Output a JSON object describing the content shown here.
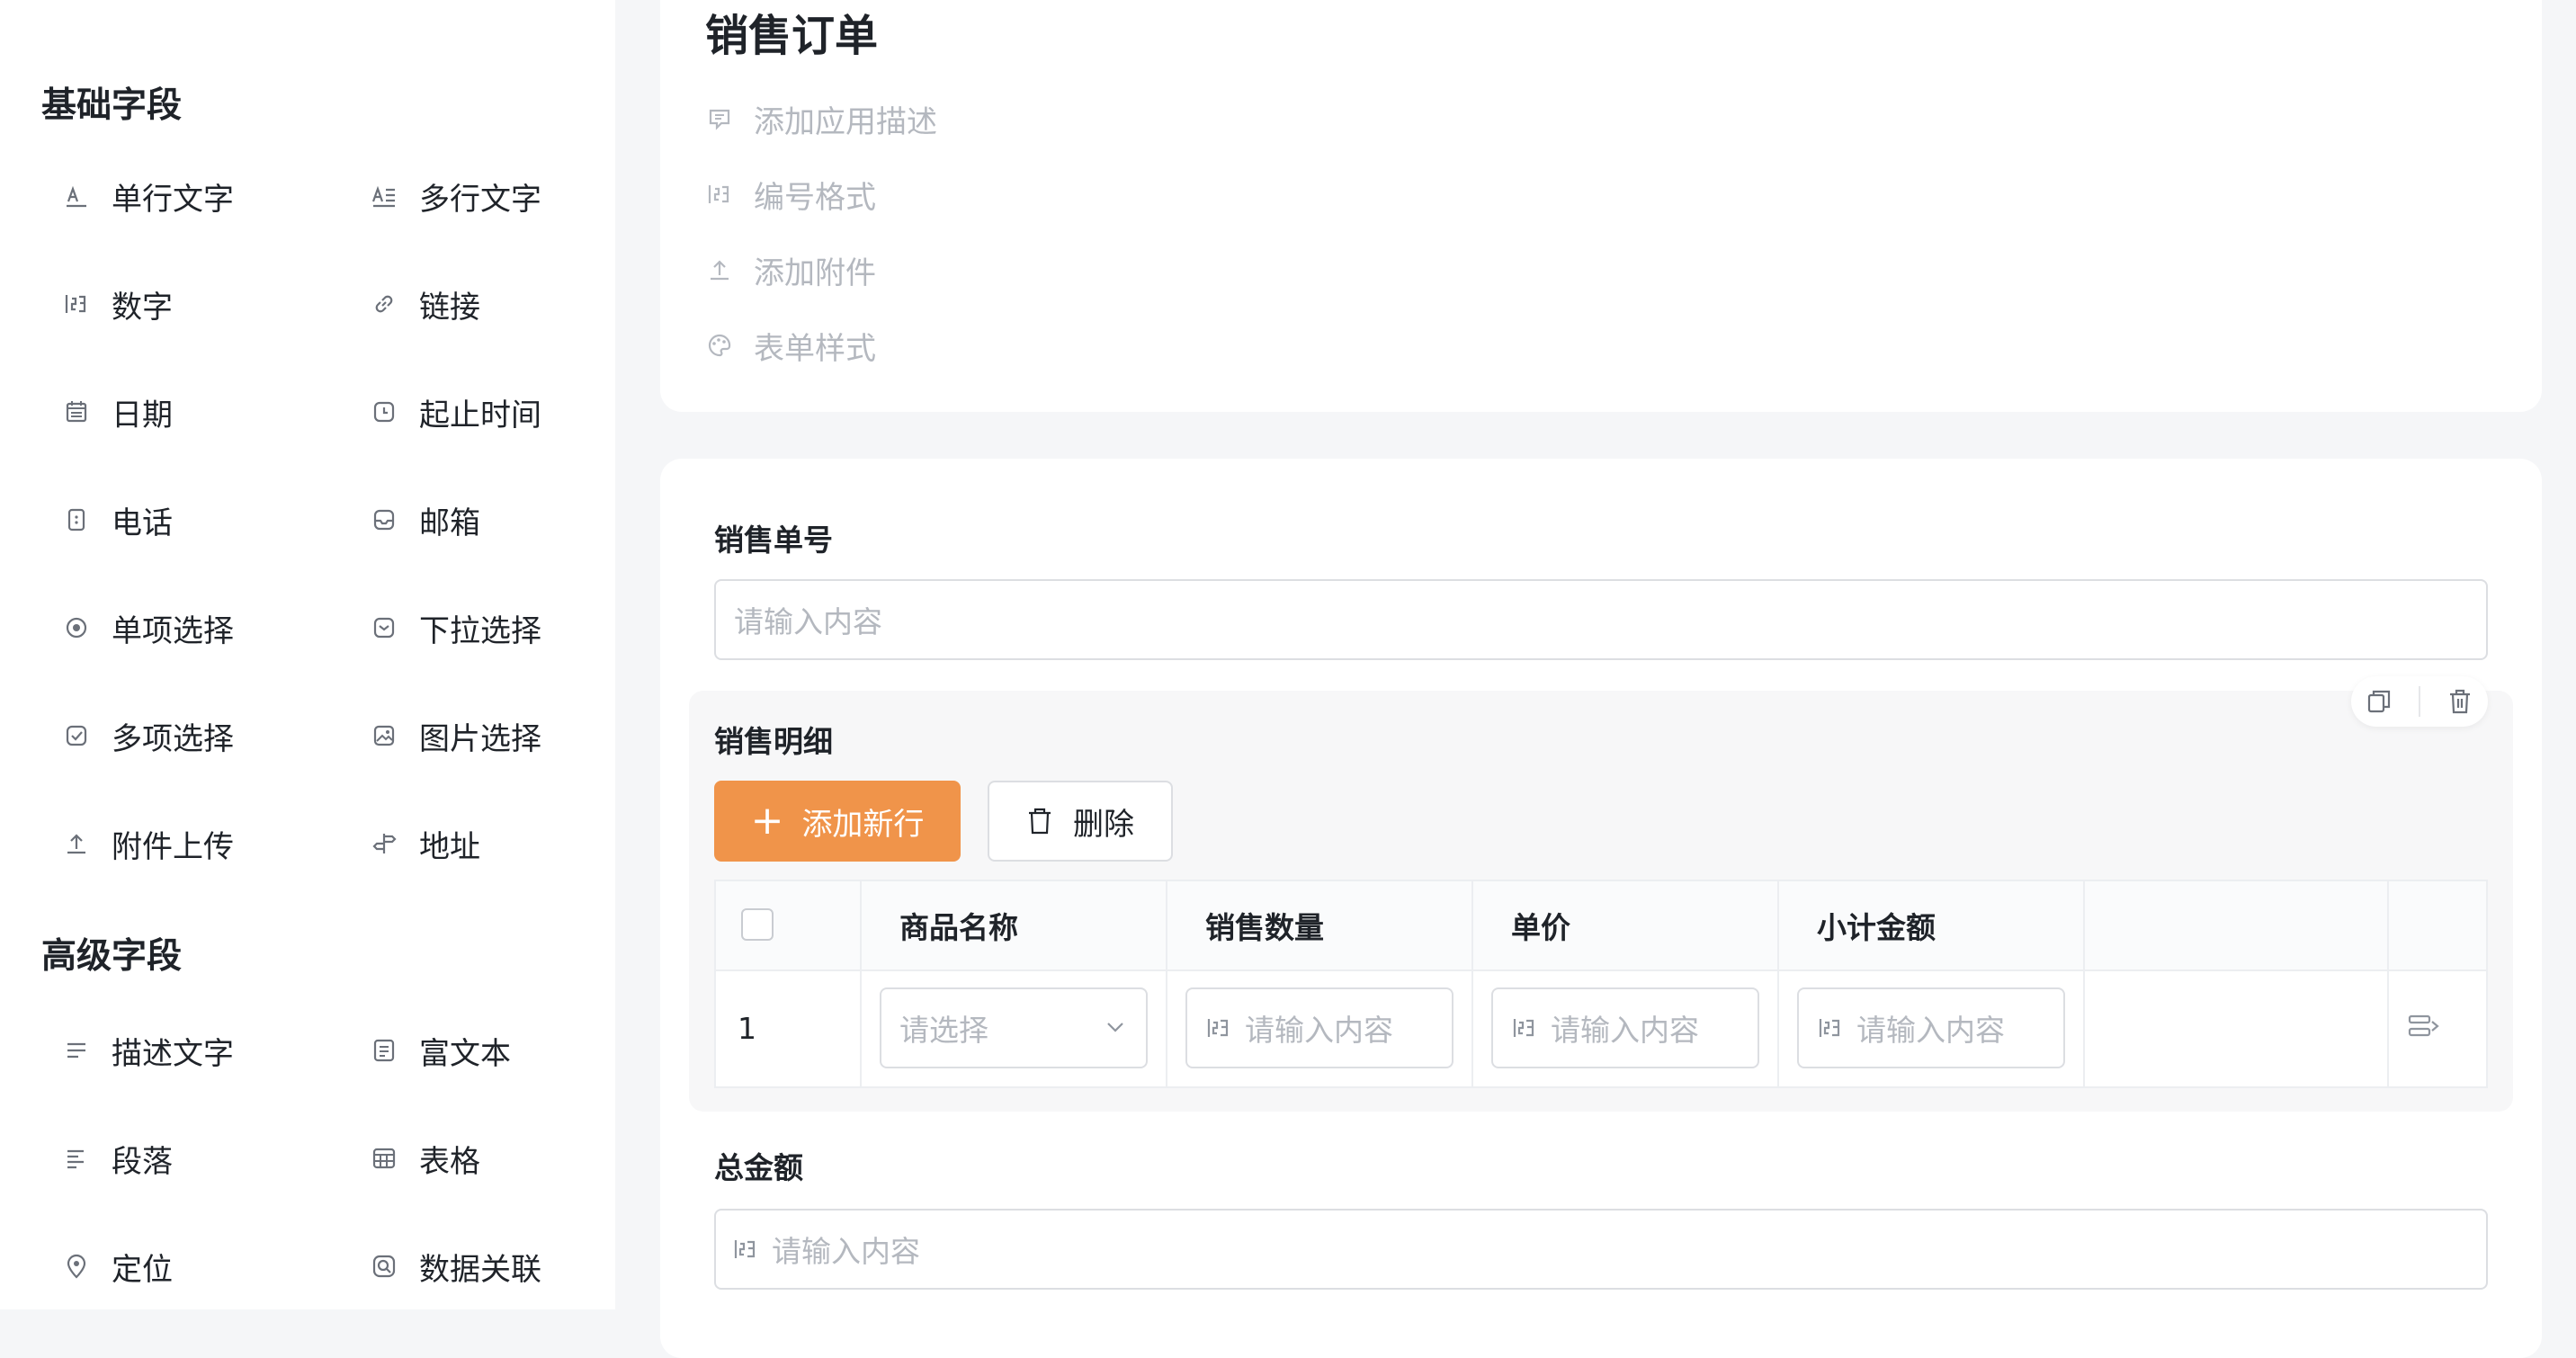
{
  "sidebar": {
    "basic_title": "基础字段",
    "advanced_title": "高级字段",
    "basic_fields": [
      {
        "label": "单行文字",
        "icon": "single-line-text-icon"
      },
      {
        "label": "多行文字",
        "icon": "multi-line-text-icon"
      },
      {
        "label": "数字",
        "icon": "number-icon"
      },
      {
        "label": "链接",
        "icon": "link-icon"
      },
      {
        "label": "日期",
        "icon": "calendar-icon"
      },
      {
        "label": "起止时间",
        "icon": "time-range-icon"
      },
      {
        "label": "电话",
        "icon": "phone-icon"
      },
      {
        "label": "邮箱",
        "icon": "mail-icon"
      },
      {
        "label": "单项选择",
        "icon": "radio-icon"
      },
      {
        "label": "下拉选择",
        "icon": "dropdown-icon"
      },
      {
        "label": "多项选择",
        "icon": "checkbox-icon"
      },
      {
        "label": "图片选择",
        "icon": "image-icon"
      },
      {
        "label": "附件上传",
        "icon": "upload-icon"
      },
      {
        "label": "地址",
        "icon": "signpost-icon"
      }
    ],
    "advanced_fields": [
      {
        "label": "描述文字",
        "icon": "description-icon"
      },
      {
        "label": "富文本",
        "icon": "rich-text-icon"
      },
      {
        "label": "段落",
        "icon": "paragraph-icon"
      },
      {
        "label": "表格",
        "icon": "table-icon"
      },
      {
        "label": "定位",
        "icon": "location-pin-icon"
      },
      {
        "label": "数据关联",
        "icon": "data-link-icon"
      }
    ]
  },
  "form": {
    "title": "销售订单",
    "options": [
      {
        "label": "添加应用描述",
        "icon": "comment-icon"
      },
      {
        "label": "编号格式",
        "icon": "number-format-icon"
      },
      {
        "label": "添加附件",
        "icon": "upload-icon"
      },
      {
        "label": "表单样式",
        "icon": "palette-icon"
      }
    ],
    "order_no": {
      "label": "销售单号",
      "placeholder": "请输入内容"
    },
    "detail": {
      "label": "销售明细",
      "add_row_label": "添加新行",
      "delete_label": "删除",
      "columns": [
        "商品名称",
        "销售数量",
        "单价",
        "小计金额"
      ],
      "rows": [
        {
          "index": "1",
          "product_placeholder": "请选择",
          "qty_placeholder": "请输入内容",
          "price_placeholder": "请输入内容",
          "subtotal_placeholder": "请输入内容"
        }
      ]
    },
    "total": {
      "label": "总金额",
      "placeholder": "请输入内容"
    }
  },
  "colors": {
    "accent": "#f0944a",
    "text": "#1f2329",
    "placeholder": "#b4b8bf",
    "border": "#dcdee2"
  }
}
